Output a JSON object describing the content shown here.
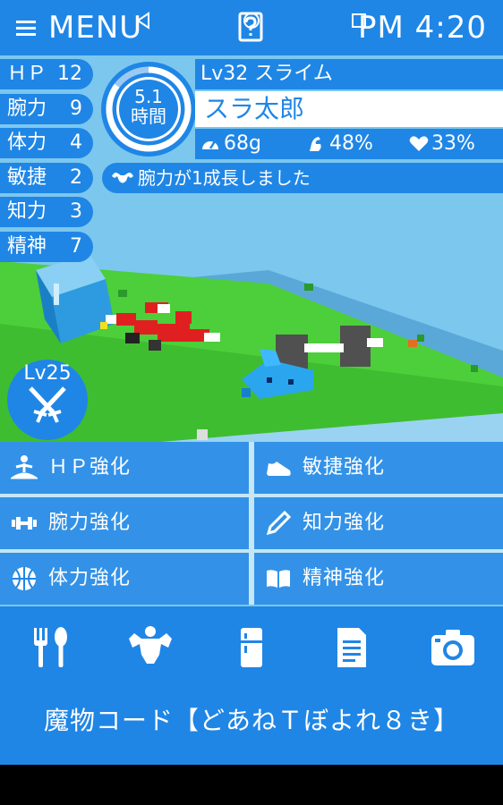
{
  "header": {
    "menu_label": "MENU",
    "clock": "PM  4:20"
  },
  "stats": [
    {
      "label": "ＨＰ",
      "value": "12"
    },
    {
      "label": "腕力",
      "value": "9"
    },
    {
      "label": "体力",
      "value": "4"
    },
    {
      "label": "敏捷",
      "value": "2"
    },
    {
      "label": "知力",
      "value": "3"
    },
    {
      "label": "精神",
      "value": "7"
    }
  ],
  "gauge": {
    "value": "5.1",
    "unit": "時間",
    "fraction": 0.85
  },
  "monster": {
    "level_type": "Lv32 スライム",
    "name": "スラ太郎",
    "weight": "68g",
    "stamina": "48%",
    "affection": "33%"
  },
  "message": "腕力が1成長しました",
  "level_badge": "Lv25",
  "training": [
    {
      "label": "ＨＰ強化",
      "icon": "meditation-icon"
    },
    {
      "label": "敏捷強化",
      "icon": "shoe-icon"
    },
    {
      "label": "腕力強化",
      "icon": "dumbbell-icon"
    },
    {
      "label": "知力強化",
      "icon": "pencil-icon"
    },
    {
      "label": "体力強化",
      "icon": "ball-icon"
    },
    {
      "label": "精神強化",
      "icon": "book-icon"
    }
  ],
  "toolbar": [
    "fork-spoon-icon",
    "muscle-icon",
    "fridge-icon",
    "document-icon",
    "camera-icon"
  ],
  "monster_code": "魔物コード【どあねＴぼよれ８き】",
  "colors": {
    "primary": "#1f86e6",
    "grass": "#4ccf3a",
    "sky": "#7cc7ee"
  }
}
